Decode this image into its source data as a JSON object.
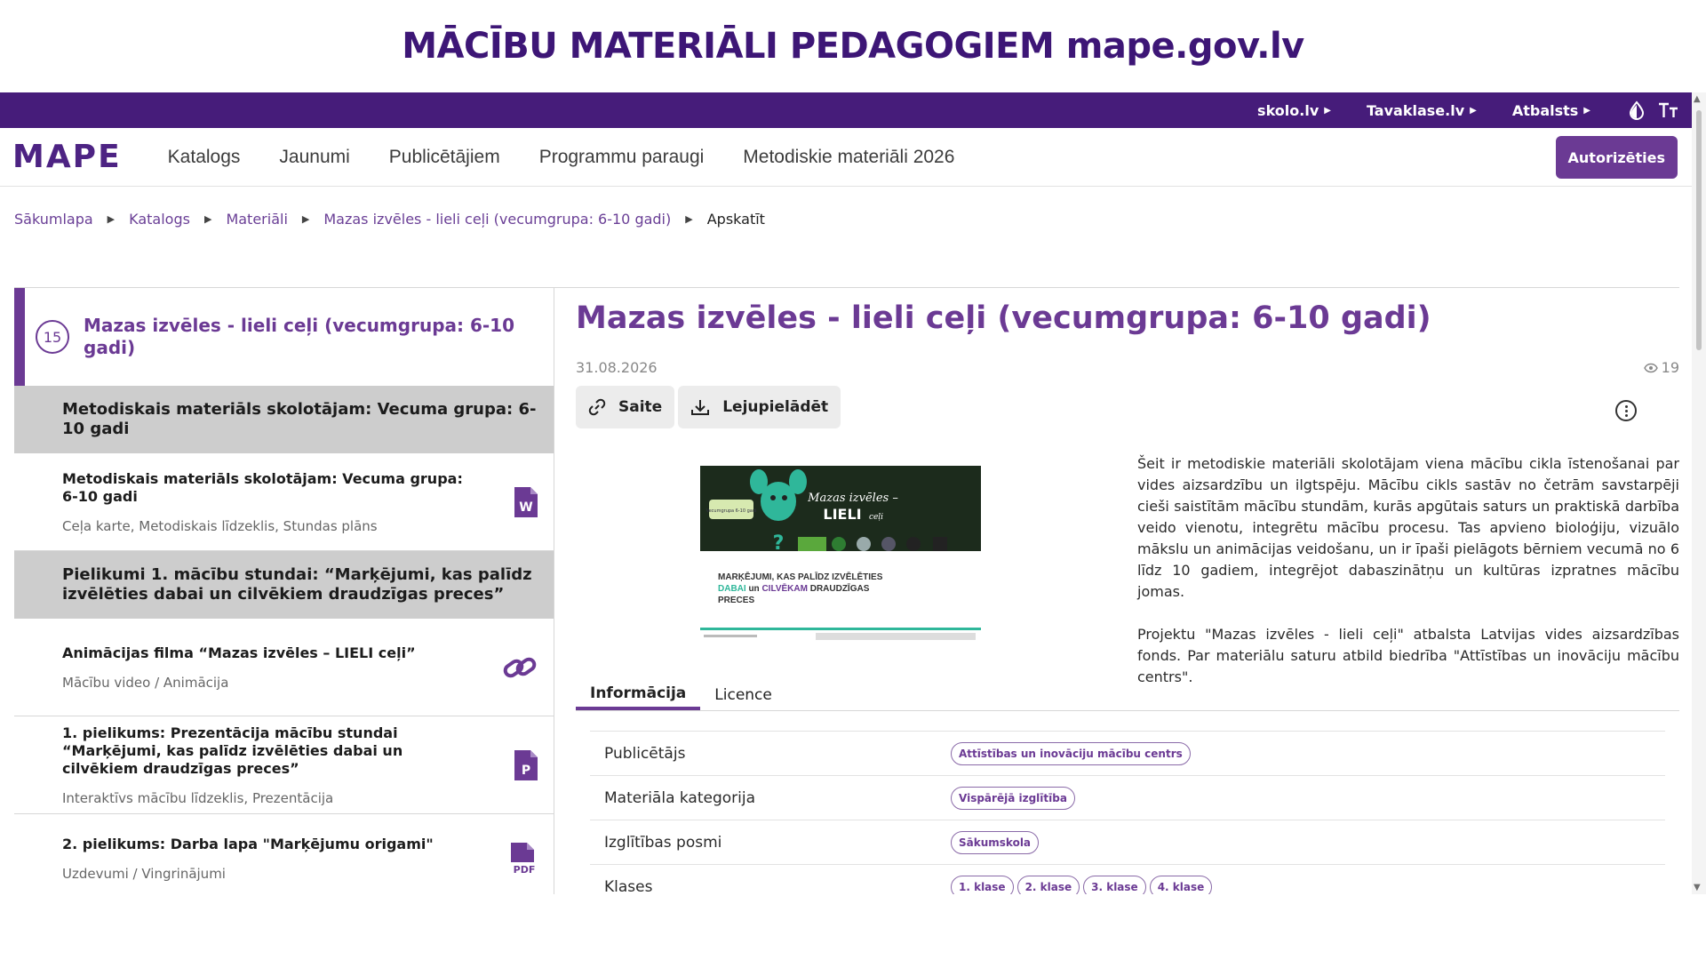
{
  "banner": "MĀCĪBU MATERIĀLI PEDAGOGIEM mape.gov.lv",
  "topbar": {
    "links": [
      "skolo.lv",
      "Tavaklase.lv",
      "Atbalsts"
    ]
  },
  "navbar": {
    "logo": "MAPE",
    "items": [
      "Katalogs",
      "Jaunumi",
      "Publicētājiem",
      "Programmu paraugi",
      "Metodiskie materiāli 2026"
    ],
    "login": "Autorizēties"
  },
  "breadcrumb": [
    "Sākumlapa",
    "Katalogs",
    "Materiāli",
    "Mazas izvēles - lieli ceļi (vecumgrupa: 6-10 gadi)",
    "Apskatīt"
  ],
  "left": {
    "count": "15",
    "title": "Mazas izvēles - lieli ceļi (vecumgrupa: 6-10 gadi)",
    "section1": "Metodiskais materiāls skolotājam: Vecuma grupa: 6-10 gadi",
    "item1": {
      "title": "Metodiskais materiāls skolotājam: Vecuma grupa: 6-10 gadi",
      "sub": "Ceļa karte, Metodiskais līdzeklis, Stundas plāns"
    },
    "section2": "Pielikumi 1. mācību stundai: “Marķējumi, kas palīdz izvēlēties dabai un cilvēkiem draudzīgas preces”",
    "item2": {
      "title": "Animācijas filma “Mazas izvēles – LIELI ceļi”",
      "sub": "Mācību video / Animācija"
    },
    "item3": {
      "title": "1. pielikums: Prezentācija mācību stundai “Marķējumi, kas palīdz izvēlēties dabai un cilvēkiem draudzīgas preces”",
      "sub": "Interaktīvs mācību līdzeklis, Prezentācija"
    },
    "item4": {
      "title": "2. pielikums: Darba lapa \"Marķējumu origami\"",
      "sub": "Uzdevumi / Vingrinājumi"
    }
  },
  "main": {
    "title": "Mazas izvēles - lieli ceļi (vecumgrupa: 6-10 gadi)",
    "date": "31.08.2026",
    "views": "19",
    "link_btn": "Saite",
    "download_btn": "Lejupielādēt",
    "desc1": "Šeit ir metodiskie materiāli skolotājam viena mācību cikla īstenošanai par vides aizsardzību un ilgtspēju. Mācību cikls sastāv no četrām savstarpēji cieši saistītām mācību stundām, kurās apgūtais saturs un praktiskā darbība veido vienotu, integrētu mācību procesu. Tas apvieno bioloģiju, vizuālo mākslu un animācijas veidošanu, un ir īpaši pielāgots bērniem vecumā no 6 līdz 10 gadiem, integrējot dabaszinātņu un kultūras izpratnes mācību jomas.",
    "desc2": "Projektu \"Mazas izvēles - lieli ceļi\" atbalsta Latvijas vides aizsardzības fonds. Par materiālu saturu atbild biedrība \"Attīstības un inovāciju mācību centrs\".",
    "image": {
      "headline1": "Mazas izvēles –",
      "headline2": "LIELI",
      "headline3": "ceļi",
      "badge": "Vecumgrupa 6-10 gadi",
      "line1": "MARĶĒJUMI, KAS PALĪDZ IZVĒLĒTIES",
      "line2a": "DABAI",
      "line2b": "un",
      "line2c": "CILVĒKAM",
      "line2d": "DRAUDZĪGAS",
      "line3": "PRECES"
    },
    "tabs": [
      "Informācija",
      "Licence"
    ],
    "info": {
      "publisher_label": "Publicētājs",
      "publisher": "Attīstības un inovāciju mācību centrs",
      "category_label": "Materiāla kategorija",
      "category": "Vispārējā izglītība",
      "stage_label": "Izglītības posmi",
      "stage": "Sākumskola",
      "grades_label": "Klases",
      "grades": [
        "1. klase",
        "2. klase",
        "3. klase",
        "4. klase"
      ]
    }
  },
  "colors": {
    "brand": "#461c7a",
    "accent": "#6b3a94",
    "section_bg": "#cdcdcd"
  }
}
